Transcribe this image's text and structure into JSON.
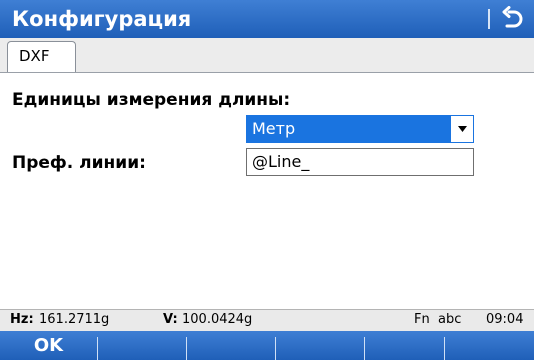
{
  "window": {
    "title": "Конфигурация",
    "back_icon": "back-arrow-icon"
  },
  "tabs": [
    {
      "label": "DXF",
      "active": true
    }
  ],
  "form": {
    "length_units": {
      "label": "Единицы измерения длины:",
      "selected": "Метр"
    },
    "line_prefix": {
      "label": "Преф. линии:",
      "value": "@Line_"
    }
  },
  "status": {
    "hz_label": "Hz:",
    "hz_value": "161.2711g",
    "v_label": "V:",
    "v_value": "100.0424g",
    "input_mode": "Fn  abc",
    "time": "09:04"
  },
  "softkeys": [
    {
      "label": "OK"
    },
    {
      "label": ""
    },
    {
      "label": ""
    },
    {
      "label": ""
    },
    {
      "label": ""
    },
    {
      "label": ""
    }
  ],
  "colors": {
    "title_bar": "#2a6cc7",
    "selection": "#1a74e0",
    "status_bar": "#eaeaea"
  }
}
